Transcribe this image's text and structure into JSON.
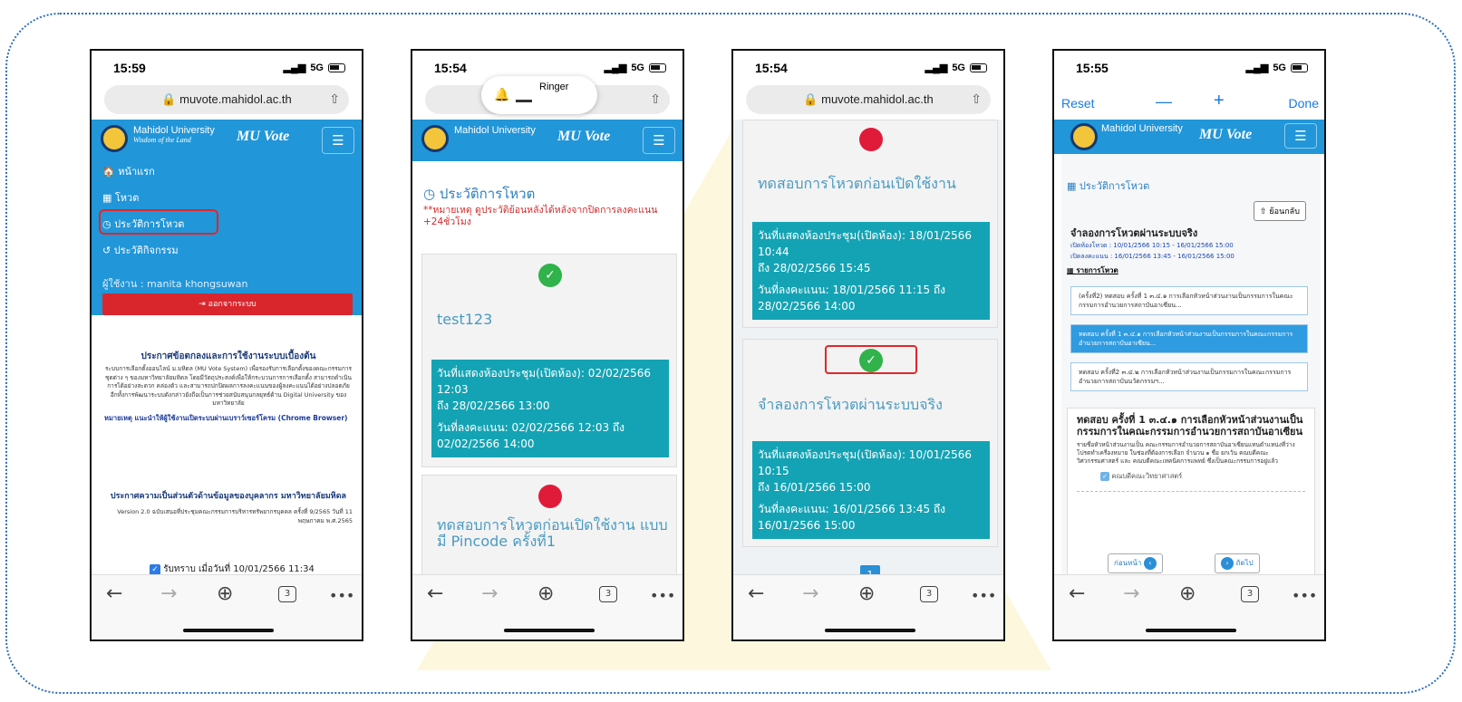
{
  "phone1": {
    "time": "15:59",
    "signal": "5G",
    "url": "muvote.mahidol.ac.th",
    "brand": "Mahidol University",
    "brand_tag": "Wisdom of the Land",
    "app_name": "MU Vote",
    "nav": [
      "หน้าแรก",
      "โหวต",
      "ประวัติการโหวต",
      "ประวัติกิจกรรม"
    ],
    "user": "ผู้ใช้งาน : manita khongsuwan",
    "logout": "ออกจากระบบ",
    "terms_title": "ประกาศข้อตกลงและการใช้งานระบบเบื้องต้น",
    "terms_body": "ระบบการเลือกตั้งออนไลน์ ม.มหิดล (MU Vote System) เพื่อรองรับการเลือกตั้งของคณะกรรมการชุดต่าง ๆ ของมหาวิทยาลัยมหิดล โดยมีวัตถุประสงค์เพื่อให้กระบวนการการเลือกตั้ง สามารถดำเนินการได้อย่างสะดวก คล่องตัว และสามารถปกปิดผลการลงคะแนนของผู้ลงคะแนนได้อย่างปลอดภัย อีกทั้งการพัฒนาระบบดังกล่าวยังถือเป็นการช่วยสนับสนุนกลยุทธ์ด้าน Digital University ของมหาวิทยาลัย",
    "browser_note": "หมายเหตุ แนะนำให้ผู้ใช้งานเปิดระบบผ่านเบราว์เซอร์โครม (Chrome Browser)",
    "privacy_title": "ประกาศความเป็นส่วนตัวด้านข้อมูลของบุคลากร มหาวิทยาลัยมหิดล",
    "privacy_body": "Version 2.0 ฉบับเสนอที่ประชุมคณะกรรมการบริหารทรัพยากรบุคคล ครั้งที่ 9/2565 วันที่ 11 พฤษภาคม พ.ศ.2565",
    "accept": "รับทราบ เมื่อวันที่ 10/01/2566 11:34",
    "tabs": "3"
  },
  "phone2": {
    "time": "15:54",
    "signal": "5G",
    "ringer": "Ringer",
    "brand": "Mahidol University",
    "app_name": "MU Vote",
    "history_title": "ประวัติการโหวต",
    "note": "**หมายเหตุ ดูประวัติย้อนหลังได้หลังจากปิดการลงคะแนน +24ชั่วโมง",
    "card1_title": "test123",
    "card1_room": "วันที่แสดงห้องประชุม(เปิดห้อง): 02/02/2566 12:03",
    "card1_room_to": "ถึง 28/02/2566 13:00",
    "card1_vote": "วันที่ลงคะแนน: 02/02/2566 12:03 ถึง 02/02/2566 14:00",
    "card2_title": "ทดสอบการโหวตก่อนเปิดใช้งาน แบบ มี Pincode ครั้งที่1",
    "tabs": "3"
  },
  "phone3": {
    "time": "15:54",
    "signal": "5G",
    "url": "muvote.mahidol.ac.th",
    "card1_title": "ทดสอบการโหวตก่อนเปิดใช้งาน",
    "card1_room": "วันที่แสดงห้องประชุม(เปิดห้อง): 18/01/2566 10:44",
    "card1_room_to": "ถึง 28/02/2566 15:45",
    "card1_vote": "วันที่ลงคะแนน: 18/01/2566 11:15 ถึง 28/02/2566 14:00",
    "card2_title": "จำลองการโหวตผ่านระบบจริง",
    "card2_room": "วันที่แสดงห้องประชุม(เปิดห้อง): 10/01/2566 10:15",
    "card2_room_to": "ถึง 16/01/2566 15:00",
    "card2_vote": "วันที่ลงคะแนน: 16/01/2566 13:45 ถึง 16/01/2566 15:00",
    "page": "1",
    "tabs": "3"
  },
  "phone4": {
    "time": "15:55",
    "signal": "5G",
    "reset": "Reset",
    "minus": "—",
    "plus": "+",
    "done": "Done",
    "brand": "Mahidol University",
    "app_name": "MU Vote",
    "history_title": "ประวัติการโหวต",
    "back": "ย้อนกลับ",
    "vote_title": "จำลองการโหวตผ่านระบบจริง",
    "open_room": "เปิดห้องโหวต : 10/01/2566 10:15 - 16/01/2566 15:00",
    "open_vote": "เปิดลงคะแนน : 16/01/2566 13:45 - 16/01/2566 15:00",
    "list_title": "รายการโหวต",
    "items": [
      "(ครั้งที่2) ทดสอบ ครั้งที่ 1 ๓.๔.๑ การเลือกหัวหน้าส่วนงานเป็นกรรมการในคณะกรรมการอำนวยการสถาบันอาเซียน...",
      "ทดสอบ ครั้งที่ 1 ๓.๔.๑ การเลือกหัวหน้าส่วนงานเป็นกรรมการในคณะกรรมการอำนวยการสถาบันอาเซียน...",
      "ทดสอบ ครั้งที่2 ๓.๔.๒ การเลือกหัวหน้าส่วนงานเป็นกรรมการในคณะกรรมการอำนวยการสถาบันนวัตกรรมฯ..."
    ],
    "detail_title": "ทดสอบ ครั้งที่ 1 ๓.๔.๑ การเลือกหัวหน้าส่วนงานเป็นกรรมการในคณะกรรมการอำนวยการสถาบันอาเซียน",
    "detail_body": "รายชื่อหัวหน้าส่วนงานเป็น คณะกรรมการอำนวยการสถาบันอาเซียนแทนตำแหน่งที่ว่าง โปรดทำเครื่องหมาย ในช่องที่ต้องการเลือก จำนวน ๑ ชื่อ ยกเว้น คณบดีคณะวิศวกรรมศาสตร์ และ คณบดีคณะเทคนิคการแพทย์ ซึ่งเป็นคณะกรรมการอยู่แล้ว",
    "choice": "คณบดีคณะวิทยาศาสตร์",
    "prev": "ก่อนหน้า",
    "next": "ถัดไป",
    "tabs": "3"
  }
}
